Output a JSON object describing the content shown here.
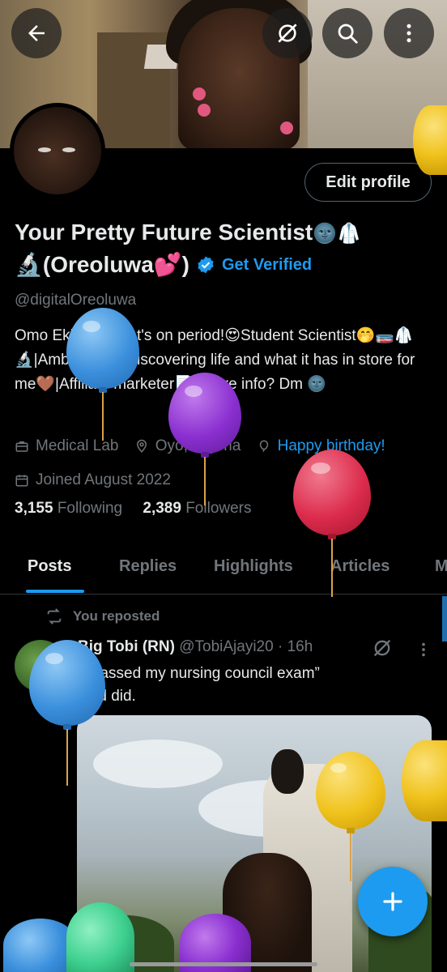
{
  "header": {
    "back_icon": "arrow-left-icon",
    "grok_icon": "slash-circle-icon",
    "search_icon": "search-icon",
    "more_icon": "more-vertical-icon"
  },
  "profile": {
    "edit_button": "Edit profile",
    "name_line1": "Your Pretty Future Scientist",
    "name_emoji1": "🌚🥼",
    "name_line2_prefix": "🔬(Oreoluwa💕)",
    "get_verified": "Get Verified",
    "handle": "@digitalOreoluwa",
    "bio": "Omo Ekiti and that's on period!😍Student Scientist🤭🧫🥼🔬|Ambivert💕| Discovering life and what it has in store for me🤎|Affiliate marketer📑, more info? Dm 🌚",
    "meta": {
      "profession": "Medical Lab",
      "location": "Oyo, Nigeria",
      "birthday_link": "Happy birthday!",
      "joined": "Joined August 2022"
    },
    "stats": {
      "following_count": "3,155",
      "following_label": "Following",
      "followers_count": "2,389",
      "followers_label": "Followers"
    }
  },
  "tabs": [
    {
      "label": "Posts",
      "active": true
    },
    {
      "label": "Replies",
      "active": false
    },
    {
      "label": "Highlights",
      "active": false
    },
    {
      "label": "Articles",
      "active": false
    },
    {
      "label": "M",
      "active": false
    }
  ],
  "post": {
    "repost_label": "You reposted",
    "author_name": "Big Tobi (RN)",
    "author_handle": "@TobiAjayi20",
    "time": "· 16h",
    "text_line1": "“I passed my nursing council exam”",
    "text_line2": "God did."
  },
  "colors": {
    "accent": "#1d9bf0",
    "background": "#000000",
    "secondary_text": "#71767b"
  }
}
